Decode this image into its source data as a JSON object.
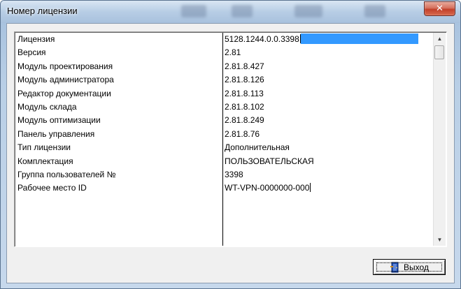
{
  "window": {
    "title": "Номер лицензии",
    "close_glyph": "✕"
  },
  "license_table": {
    "rows": [
      {
        "name": "Лицензия",
        "value": "5128.1244.0.0.3398"
      },
      {
        "name": "Версия",
        "value": "2.81"
      },
      {
        "name": "Модуль проектирования",
        "value": "2.81.8.427"
      },
      {
        "name": "Модуль администратора",
        "value": "2.81.8.126"
      },
      {
        "name": "Редактор документации",
        "value": "2.81.8.113"
      },
      {
        "name": "Модуль склада",
        "value": "2.81.8.102"
      },
      {
        "name": "Модуль оптимизации",
        "value": "2.81.8.249"
      },
      {
        "name": "Панель управления",
        "value": "2.81.8.76"
      },
      {
        "name": "Тип лицензии",
        "value": "Дополнительная"
      },
      {
        "name": "Комплектация",
        "value": "ПОЛЬЗОВАТЕЛЬСКАЯ"
      },
      {
        "name": "Группа пользователей №",
        "value": "3398"
      },
      {
        "name": "Рабочее место ID",
        "value": "WT-VPN-0000000-000"
      }
    ]
  },
  "scrollbar": {
    "up_glyph": "▲",
    "down_glyph": "▼"
  },
  "exit_button": {
    "label": "Выход",
    "icon": "door-exit-icon"
  },
  "colors": {
    "selection": "#3399ff",
    "close_button": "#c7412b",
    "client_bg": "#f0f0f0"
  }
}
